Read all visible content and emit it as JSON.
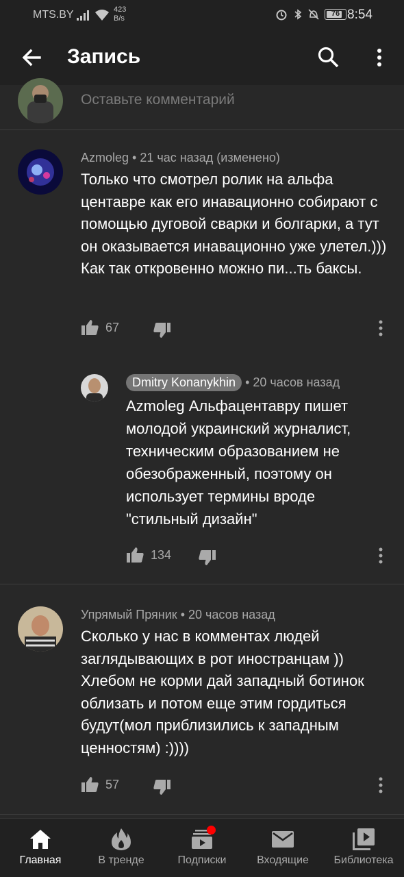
{
  "status_bar": {
    "carrier": "MTS.BY",
    "speed_value": "423",
    "speed_unit": "B/s",
    "battery": "76",
    "time": "8:54"
  },
  "app_bar": {
    "title": "Запись",
    "back_icon": "arrow-left-icon",
    "search_icon": "search-icon",
    "more_icon": "more-vert-icon"
  },
  "add_comment": {
    "placeholder": "Оставьте комментарий"
  },
  "comments": [
    {
      "author": "Azmoleg",
      "meta": "21 час назад (изменено)",
      "text": "Только что смотрел ролик на альфа центавре как его инавационно собирают с помощью дуговой сварки и болгарки, а тут он оказывается инавационно уже улетел.)))  Как так откровенно можно пи...ть баксы.",
      "likes": "67"
    },
    {
      "author": "Dmitry Konanykhin",
      "meta": "20 часов назад",
      "text": "Azmoleg Альфацентавру пишет молодой украинский журналист, техническим образованием не обезображенный, поэтому он использует термины вроде \"стильный дизайн\"",
      "likes": "134",
      "is_reply": true
    },
    {
      "author": "Упрямый Пряник",
      "meta": "20 часов назад",
      "text": "Сколько у нас в комментах людей заглядывающих в рот иностранцам )) Хлебом не корми дай западный ботинок облизать и потом еще этим гордиться будут(мол приблизились к западным ценностям)  :))))",
      "likes": "57"
    }
  ],
  "separator": "•",
  "bottom_nav": [
    {
      "label": "Главная",
      "icon": "home-icon",
      "active": true
    },
    {
      "label": "В тренде",
      "icon": "fire-icon"
    },
    {
      "label": "Подписки",
      "icon": "subscriptions-icon",
      "badge": true
    },
    {
      "label": "Входящие",
      "icon": "mail-icon"
    },
    {
      "label": "Библиотека",
      "icon": "library-icon"
    }
  ],
  "colors": {
    "background": "#282828",
    "bar": "#212121",
    "text_secondary": "#a8a8a8",
    "badge": "#ff0000"
  }
}
